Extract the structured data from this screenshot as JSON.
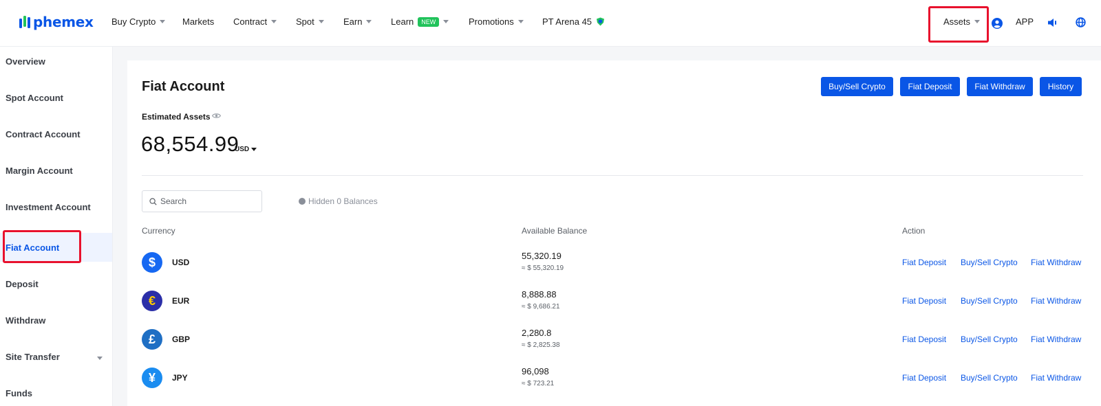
{
  "brand": {
    "name": "phemex"
  },
  "nav": {
    "items": [
      {
        "label": "Buy Crypto",
        "dropdown": true
      },
      {
        "label": "Markets",
        "dropdown": false
      },
      {
        "label": "Contract",
        "dropdown": true
      },
      {
        "label": "Spot",
        "dropdown": true
      },
      {
        "label": "Earn",
        "dropdown": true
      },
      {
        "label": "Learn",
        "dropdown": true,
        "badge": "NEW"
      },
      {
        "label": "Promotions",
        "dropdown": true
      },
      {
        "label": "PT Arena 45"
      }
    ],
    "right": {
      "assets": "Assets",
      "app": "APP"
    }
  },
  "sidebar": {
    "items": [
      {
        "label": "Overview"
      },
      {
        "label": "Spot Account"
      },
      {
        "label": "Contract Account"
      },
      {
        "label": "Margin Account"
      },
      {
        "label": "Investment Account"
      },
      {
        "label": "Fiat Account",
        "active": true
      },
      {
        "label": "Deposit"
      },
      {
        "label": "Withdraw"
      },
      {
        "label": "Site Transfer",
        "dropdown": true
      },
      {
        "label": "Funds"
      }
    ]
  },
  "main": {
    "title": "Fiat Account",
    "buttons": [
      "Buy/Sell Crypto",
      "Fiat Deposit",
      "Fiat Withdraw",
      "History"
    ],
    "estimated_label": "Estimated Assets",
    "balance": "68,554.99",
    "balance_unit": "USD",
    "search_placeholder": "Search",
    "hidden_balances": "Hidden 0 Balances",
    "columns": {
      "currency": "Currency",
      "available": "Available Balance",
      "action": "Action"
    },
    "rows": [
      {
        "code": "USD",
        "symbol": "$",
        "amount": "55,320.19",
        "usd": "≈ $ 55,320.19"
      },
      {
        "code": "EUR",
        "symbol": "€",
        "amount": "8,888.88",
        "usd": "≈ $ 9,686.21"
      },
      {
        "code": "GBP",
        "symbol": "£",
        "amount": "2,280.8",
        "usd": "≈ $ 2,825.38"
      },
      {
        "code": "JPY",
        "symbol": "¥",
        "amount": "96,098",
        "usd": "≈ $ 723.21"
      }
    ],
    "row_actions": [
      "Fiat Deposit",
      "Buy/Sell Crypto",
      "Fiat Withdraw"
    ]
  },
  "colors": {
    "accent": "#0a56e6",
    "highlight_box": "#e8112d",
    "new_badge": "#21c35b",
    "coin_usd": "#1668f2",
    "coin_eur": "#2b2fa8",
    "coin_eur_symbol": "#ffcc00",
    "coin_gbp": "#1f6fc4",
    "coin_jpy": "#1a8cf0"
  }
}
